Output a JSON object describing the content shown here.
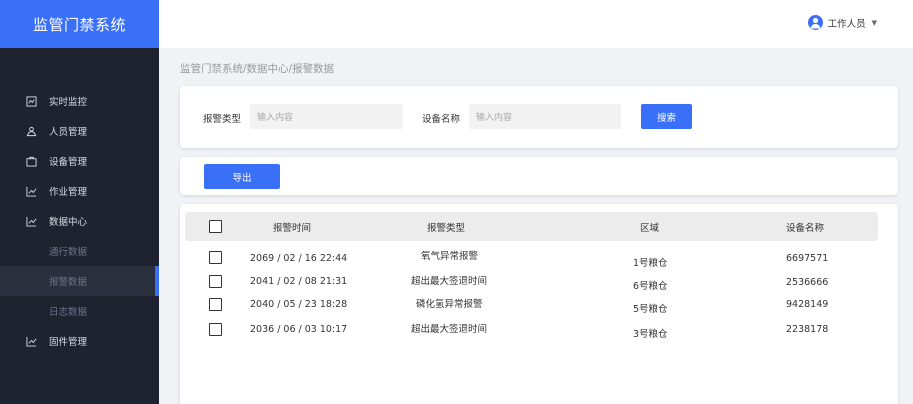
{
  "app": {
    "title": "监管门禁系统"
  },
  "user": {
    "name": "工作人员"
  },
  "sidebar": {
    "items": [
      {
        "label": "实时监控",
        "icon": "chart-icon"
      },
      {
        "label": "人员管理",
        "icon": "people-icon"
      },
      {
        "label": "设备管理",
        "icon": "device-icon"
      },
      {
        "label": "作业管理",
        "icon": "trend-icon"
      },
      {
        "label": "数据中心",
        "icon": "trend-icon"
      }
    ],
    "subitems": [
      {
        "label": "通行数据"
      },
      {
        "label": "报警数据",
        "active": true
      },
      {
        "label": "日志数据"
      }
    ],
    "last_item": {
      "label": "固件管理",
      "icon": "trend-icon"
    }
  },
  "breadcrumb": "监管门禁系统/数据中心/报警数据",
  "search": {
    "alarm_type_label": "报警类型",
    "alarm_type_placeholder": "输入内容",
    "device_name_label": "设备名称",
    "device_name_placeholder": "输入内容",
    "search_button": "搜索"
  },
  "toolbar": {
    "export_button": "导出"
  },
  "table": {
    "headers": [
      "报警时间",
      "报警类型",
      "区域",
      "设备名称"
    ],
    "rows": [
      {
        "time": "2069 / 02 / 16 22:44",
        "type": "氧气异常报警",
        "area": "1号粮仓",
        "device": "6697571"
      },
      {
        "time": "2041 / 02 / 08 21:31",
        "type": "超出最大签退时间",
        "area": "6号粮仓",
        "device": "2536666"
      },
      {
        "time": "2040 / 05 / 23 18:28",
        "type": "磷化氢异常报警",
        "area": "5号粮仓",
        "device": "9428149"
      },
      {
        "time": "2036 / 06 / 03 10:17",
        "type": "超出最大签退时间",
        "area": "3号粮仓",
        "device": "2238178"
      }
    ]
  },
  "colors": {
    "accent": "#3a6ff7",
    "sidebar_bg": "#1f2330",
    "page_bg": "#f0f2f5"
  }
}
